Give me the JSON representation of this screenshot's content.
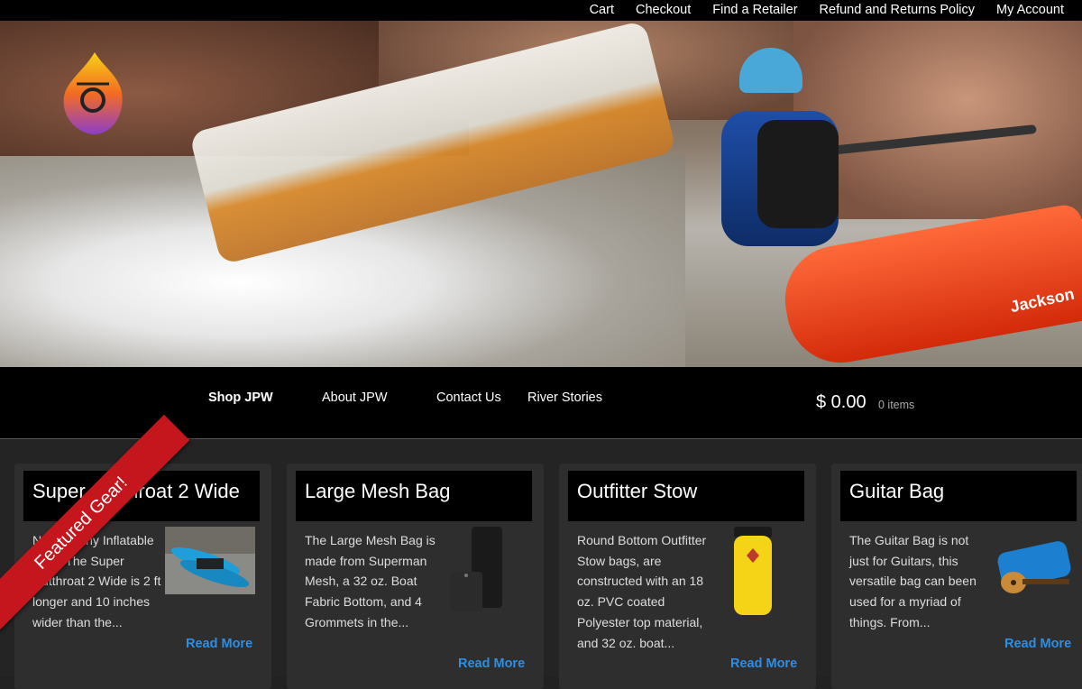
{
  "topnav": {
    "items": [
      "Cart",
      "Checkout",
      "Find a Retailer",
      "Refund and Returns Policy",
      "My Account"
    ]
  },
  "hero": {
    "kayak_brand": "Jackson"
  },
  "mainnav": {
    "items": [
      "Shop JPW",
      "About JPW",
      "Contact Us",
      "River Stories"
    ],
    "cart_total": "$ 0.00",
    "cart_items": "0 items"
  },
  "ribbon": "Featured Gear!",
  "products": [
    {
      "title": "Super Cutthroat 2 Wide",
      "description": "Not just any Inflatable Boat. The Super Cutthroat 2 Wide is 2 ft longer and 10 inches wider than the...",
      "read_more": "Read More"
    },
    {
      "title": "Large Mesh Bag",
      "description": "The Large Mesh Bag is made from Superman Mesh, a 32 oz. Boat Fabric Bottom, and 4 Grommets in the...",
      "read_more": "Read More"
    },
    {
      "title": "Outfitter Stow",
      "description": "Round Bottom Outfitter Stow bags, are constructed with an 18 oz. PVC coated Polyester top material, and 32 oz. boat...",
      "read_more": "Read More"
    },
    {
      "title": "Guitar Bag",
      "description": "The Guitar Bag is not just for Guitars, this versatile bag can been used for a myriad of things. From...",
      "read_more": "Read More"
    }
  ],
  "colors": {
    "accent_link": "#2b8fe8",
    "ribbon": "#c4161c",
    "bar": "#000000"
  }
}
